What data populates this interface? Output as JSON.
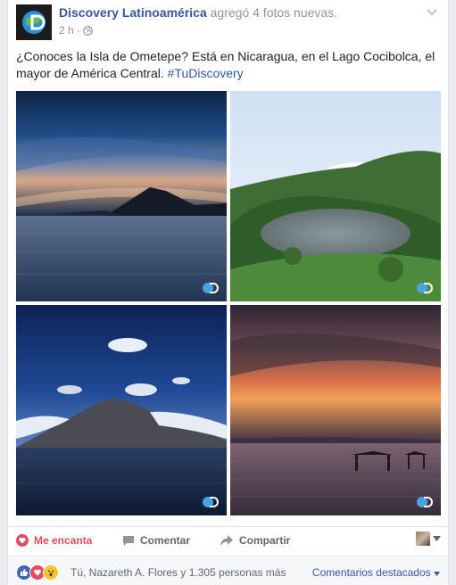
{
  "post": {
    "page_name": "Discovery Latinoamérica",
    "action_text": "agregó 4 fotos nuevas.",
    "time": "2 h",
    "separator": "·",
    "privacy_icon": "globe-icon",
    "text": "¿Conoces la Isla de Ometepe? Está en Nicaragua, en el Lago Cocibolca, el mayor de América Central.",
    "hashtag": "#TuDiscovery"
  },
  "photos": [
    {
      "name": "ometepe-volcano-sunset"
    },
    {
      "name": "crater-lagoon"
    },
    {
      "name": "volcano-clouds"
    },
    {
      "name": "lake-sunset-pier"
    }
  ],
  "actions": {
    "like_label": "Me encanta",
    "comment_label": "Comentar",
    "share_label": "Compartir"
  },
  "reactions": {
    "summary": "Tú, Nazareth A. Flores y 1.305 personas más",
    "filter_label": "Comentarios destacados",
    "icons": [
      "like-icon",
      "love-icon",
      "wow-icon"
    ]
  },
  "colors": {
    "link": "#365899",
    "love": "#e04f5f",
    "like": "#4267b2"
  }
}
